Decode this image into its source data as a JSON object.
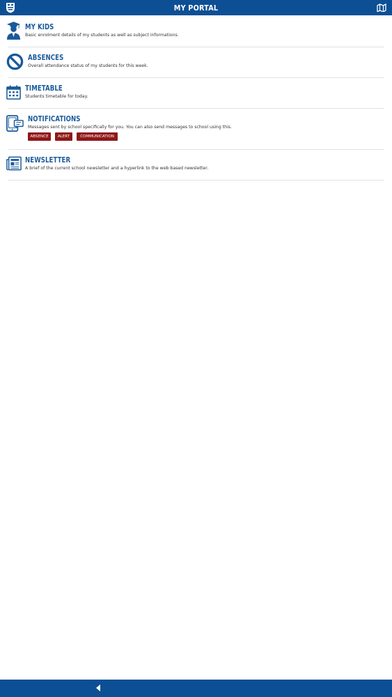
{
  "header": {
    "title": "MY PORTAL",
    "logo_icon": "school-crest-icon",
    "map_icon": "map-icon"
  },
  "items": [
    {
      "title": "MY KIDS",
      "description": "Basic enrolment details of my students as well as subject informations.",
      "icon": "graduate-icon"
    },
    {
      "title": "ABSENCES",
      "description": "Overall attendance status of my students for this week.",
      "icon": "no-entry-icon"
    },
    {
      "title": "TIMETABLE",
      "description": "Students timetable for today.",
      "icon": "calendar-icon"
    },
    {
      "title": "NOTIFICATIONS",
      "description": "Messages sent by school specifically for you. You can also send messages to school using this.",
      "icon": "tablet-message-icon",
      "tags": [
        "ABSENCE",
        "ALERT",
        "COMMUNICATION"
      ]
    },
    {
      "title": "NEWSLETTER",
      "description": "A brief of the current school newsletter and a hyperlink to the web based newsletter.",
      "icon": "newspaper-icon"
    }
  ],
  "footer": {
    "back_icon": "back-arrow-icon"
  },
  "colors": {
    "primary": "#0d4f95",
    "heading": "#1a5a9a",
    "tag": "#8f1818"
  }
}
